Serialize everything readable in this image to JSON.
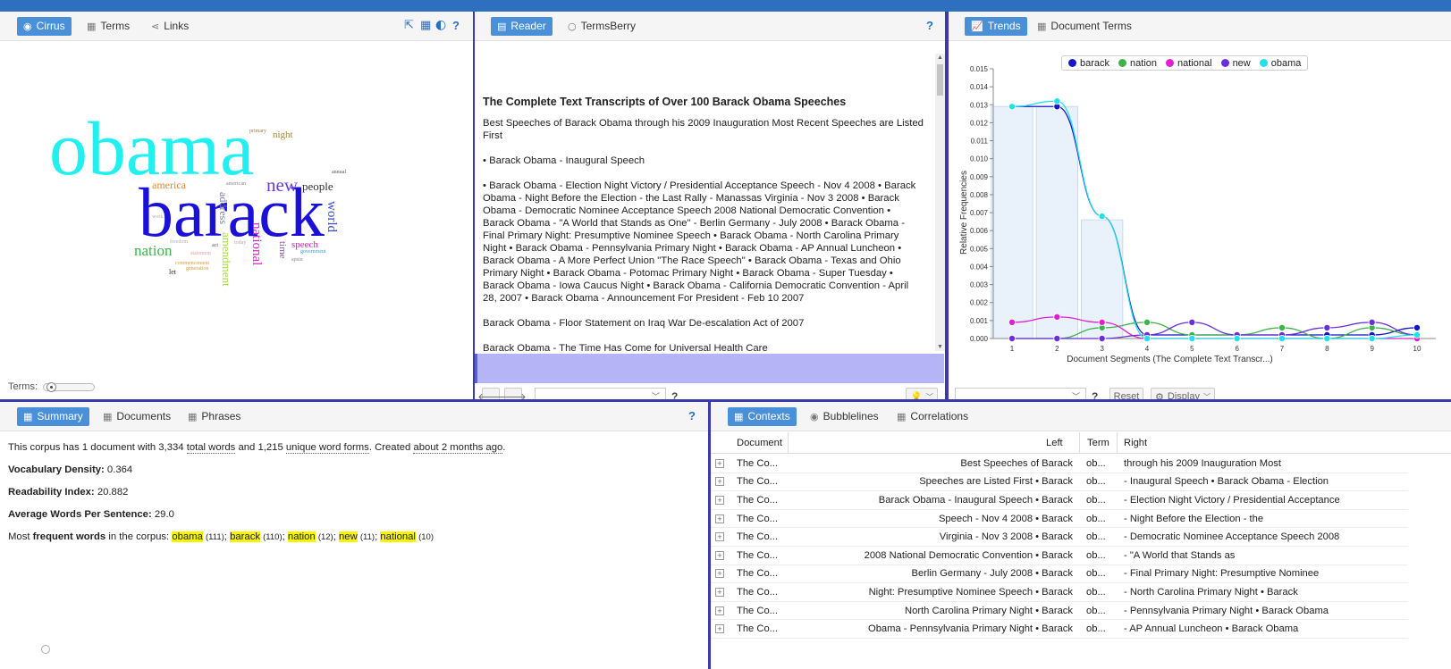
{
  "cirrus_panel": {
    "tabs": [
      {
        "label": "Cirrus",
        "icon": "eye-icon"
      },
      {
        "label": "Terms",
        "icon": "table-icon"
      },
      {
        "label": "Links",
        "icon": "share-icon"
      }
    ],
    "help": "?",
    "slider_label": "Terms:",
    "cloud_words": [
      {
        "text": "obama",
        "color": "#22f0f0"
      },
      {
        "text": "barack",
        "color": "#1b10d8"
      },
      {
        "text": "new",
        "color": "#6a3fd8"
      },
      {
        "text": "nation",
        "color": "#3db34a"
      },
      {
        "text": "national",
        "color": "#e020d0"
      },
      {
        "text": "people",
        "color": "#333333"
      },
      {
        "text": "america",
        "color": "#e08a2a"
      },
      {
        "text": "address",
        "color": "#7a7aa0"
      },
      {
        "text": "amendment",
        "color": "#a8e040"
      },
      {
        "text": "world",
        "color": "#3a4ad0"
      },
      {
        "text": "speech",
        "color": "#d020c0"
      },
      {
        "text": "time",
        "color": "#a04ad0"
      },
      {
        "text": "night",
        "color": "#a08a3a"
      },
      {
        "text": "primary",
        "color": "#a07a3a"
      },
      {
        "text": "let",
        "color": "#333333"
      },
      {
        "text": "today",
        "color": "#aaaaaa"
      },
      {
        "text": "act",
        "color": "#555555"
      },
      {
        "text": "government",
        "color": "#3aa0d0"
      },
      {
        "text": "commencement",
        "color": "#e09a3a"
      },
      {
        "text": "generation",
        "color": "#d0a03a"
      },
      {
        "text": "statement",
        "color": "#e0a0a0"
      },
      {
        "text": "freedom",
        "color": "#b0b0b0"
      },
      {
        "text": "annual",
        "color": "#555555"
      },
      {
        "text": "american",
        "color": "#888888"
      },
      {
        "text": "work",
        "color": "#b0b0b0"
      },
      {
        "text": "apsin",
        "color": "#888888"
      }
    ]
  },
  "reader_panel": {
    "tabs": [
      {
        "label": "Reader",
        "icon": "document-icon"
      },
      {
        "label": "TermsBerry",
        "icon": "circle-icon"
      }
    ],
    "help": "?",
    "title": "The Complete Text Transcripts of Over 100 Barack Obama Speeches",
    "paragraphs": [
      "Best Speeches of Barack Obama through his 2009 Inauguration Most Recent Speeches are Listed First",
      "• Barack Obama - Inaugural Speech",
      "• Barack Obama - Election Night Victory / Presidential Acceptance Speech - Nov 4 2008 • Barack Obama - Night Before the Election - the Last Rally - Manassas Virginia - Nov 3 2008 • Barack Obama - Democratic Nominee Acceptance Speech 2008 National Democratic Convention • Barack Obama - \"A World that Stands as One\" - Berlin Germany - July 2008 • Barack Obama - Final Primary Night: Presumptive Nominee Speech • Barack Obama - North Carolina Primary Night • Barack Obama - Pennsylvania Primary Night • Barack Obama - AP Annual Luncheon • Barack Obama - A More Perfect Union \"The Race Speech\" • Barack Obama - Texas and Ohio Primary Night • Barack Obama - Potomac Primary Night • Barack Obama - Super Tuesday • Barack Obama - Iowa Caucus Night • Barack Obama - California Democratic Convention - April 28, 2007 • Barack Obama - Announcement For President - Feb 10 2007",
      "Barack Obama - Floor Statement on Iraq War De-escalation Act of 2007",
      "Barack Obama - The Time Has Come for Universal Health Care"
    ],
    "help2": "?"
  },
  "trends_panel": {
    "tabs": [
      {
        "label": "Trends",
        "icon": "chart-icon"
      },
      {
        "label": "Document Terms",
        "icon": "table-icon"
      }
    ],
    "help": "?",
    "reset_label": "Reset",
    "display_label": "Display",
    "colors": {
      "barack": "#1515c8",
      "nation": "#3db34a",
      "national": "#e020d0",
      "new": "#6a2fd8",
      "obama": "#22e0e8"
    }
  },
  "chart_data": {
    "type": "line",
    "xlabel": "Document Segments (The Complete Text Transcr...)",
    "ylabel": "Relative Frequencies",
    "x": [
      1,
      2,
      3,
      4,
      5,
      6,
      7,
      8,
      9,
      10
    ],
    "ylim": [
      0,
      0.015
    ],
    "yticks": [
      "0.000",
      "0.001",
      "0.002",
      "0.003",
      "0.004",
      "0.005",
      "0.006",
      "0.007",
      "0.008",
      "0.009",
      "0.010",
      "0.011",
      "0.012",
      "0.013",
      "0.014",
      "0.015"
    ],
    "legend_position": "top",
    "series": [
      {
        "name": "barack",
        "values": [
          0.0129,
          0.0129,
          0.0068,
          0.0002,
          0.0002,
          0.0002,
          0.0002,
          0.0002,
          0.0002,
          0.0006
        ]
      },
      {
        "name": "nation",
        "values": [
          0.0,
          0.0,
          0.0006,
          0.0009,
          0.0002,
          0.0002,
          0.0006,
          0.0,
          0.0006,
          0.0002
        ]
      },
      {
        "name": "national",
        "values": [
          0.0009,
          0.0012,
          0.0009,
          0.0,
          0.0,
          0.0,
          0.0,
          0.0,
          0.0,
          0.0
        ]
      },
      {
        "name": "new",
        "values": [
          0.0,
          0.0,
          0.0,
          0.0002,
          0.0009,
          0.0002,
          0.0002,
          0.0006,
          0.0009,
          0.0002
        ]
      },
      {
        "name": "obama",
        "values": [
          0.0129,
          0.0132,
          0.0068,
          0.0,
          0.0,
          0.0,
          0.0,
          0.0,
          0.0,
          0.0002
        ]
      }
    ],
    "bars": [
      0.0129,
      0.0129,
      0.0066,
      0.0,
      0.0,
      0.0,
      0.0,
      0.0,
      0.0,
      0.0
    ]
  },
  "summary_panel": {
    "tabs": [
      {
        "label": "Summary",
        "icon": "table-icon"
      },
      {
        "label": "Documents",
        "icon": "table-icon"
      },
      {
        "label": "Phrases",
        "icon": "table-icon"
      }
    ],
    "help": "?",
    "line1_a": "This corpus has 1 document with 3,334 ",
    "line1_b": "total words",
    "line1_c": " and 1,215 ",
    "line1_d": "unique word forms",
    "line1_e": ". Created ",
    "line1_f": "about 2 months ago",
    "line1_g": ".",
    "vd_label": "Vocabulary Density:",
    "vd_value": "0.364",
    "ri_label": "Readability Index:",
    "ri_value": "20.882",
    "aw_label": "Average Words Per Sentence:",
    "aw_value": "29.0",
    "freq_a": "Most ",
    "freq_b": "frequent words",
    "freq_c": " in the corpus: ",
    "freq_words": [
      {
        "word": "obama",
        "count": "(111)"
      },
      {
        "word": "barack",
        "count": "(110)"
      },
      {
        "word": "nation",
        "count": "(12)"
      },
      {
        "word": "new",
        "count": "(11)"
      },
      {
        "word": "national",
        "count": "(10)"
      }
    ]
  },
  "contexts_panel": {
    "tabs": [
      {
        "label": "Contexts",
        "icon": "table-icon"
      },
      {
        "label": "Bubblelines",
        "icon": "eye-icon"
      },
      {
        "label": "Correlations",
        "icon": "table-icon"
      }
    ],
    "columns": {
      "document": "Document",
      "left": "Left",
      "term": "Term",
      "right": "Right"
    },
    "rows": [
      {
        "doc": "The Co...",
        "left": "Best Speeches of Barack",
        "term": "ob...",
        "right": "through his 2009 Inauguration Most"
      },
      {
        "doc": "The Co...",
        "left": "Speeches are Listed First • Barack",
        "term": "ob...",
        "right": "- Inaugural Speech • Barack Obama - Election"
      },
      {
        "doc": "The Co...",
        "left": "Barack Obama - Inaugural Speech • Barack",
        "term": "ob...",
        "right": "- Election Night Victory / Presidential Acceptance"
      },
      {
        "doc": "The Co...",
        "left": "Speech - Nov 4 2008 • Barack",
        "term": "ob...",
        "right": "- Night Before the Election - the"
      },
      {
        "doc": "The Co...",
        "left": "Virginia - Nov 3 2008 • Barack",
        "term": "ob...",
        "right": "- Democratic Nominee Acceptance Speech 2008"
      },
      {
        "doc": "The Co...",
        "left": "2008 National Democratic Convention • Barack",
        "term": "ob...",
        "right": "- \"A World that Stands as"
      },
      {
        "doc": "The Co...",
        "left": "Berlin Germany - July 2008 • Barack",
        "term": "ob...",
        "right": "- Final Primary Night: Presumptive Nominee"
      },
      {
        "doc": "The Co...",
        "left": "Night: Presumptive Nominee Speech • Barack",
        "term": "ob...",
        "right": "- North Carolina Primary Night • Barack"
      },
      {
        "doc": "The Co...",
        "left": "North Carolina Primary Night • Barack",
        "term": "ob...",
        "right": "- Pennsylvania Primary Night • Barack Obama"
      },
      {
        "doc": "The Co...",
        "left": "Obama - Pennsylvania Primary Night • Barack",
        "term": "ob...",
        "right": "- AP Annual Luncheon • Barack Obama"
      }
    ]
  }
}
